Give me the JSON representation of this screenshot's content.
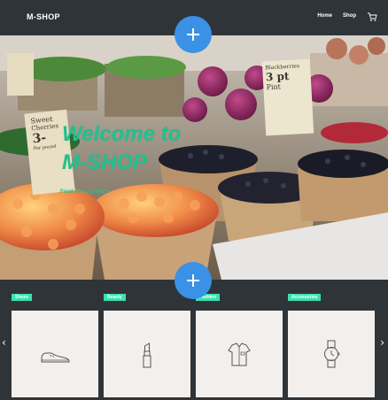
{
  "header": {
    "brand": "M-SHOP",
    "nav": [
      "Home",
      "Shop"
    ],
    "cart_icon": "cart-icon"
  },
  "hero": {
    "title_line1": "Welcome to",
    "title_line2": "M-SHOP",
    "subtitle": "Food For Life Smile",
    "signs": [
      "Sweet",
      "Cherries",
      "3-",
      "Per pound",
      "Blackberries",
      "3 pt",
      "Pint"
    ]
  },
  "actions": {
    "add_icon": "plus-icon"
  },
  "products": [
    {
      "tag": "Shoes",
      "icon": "shoe-icon"
    },
    {
      "tag": "Beauty",
      "icon": "lipstick-icon"
    },
    {
      "tag": "Fashion",
      "icon": "shirt-icon"
    },
    {
      "tag": "Accessories",
      "icon": "watch-icon"
    }
  ],
  "carousel": {
    "prev": "‹",
    "next": "›"
  },
  "colors": {
    "header_bg": "#2f3438",
    "accent_blue": "#3a91e6",
    "accent_green": "#1ec28f",
    "tag_green": "#3be1b0",
    "card_bg": "#f3efed"
  }
}
